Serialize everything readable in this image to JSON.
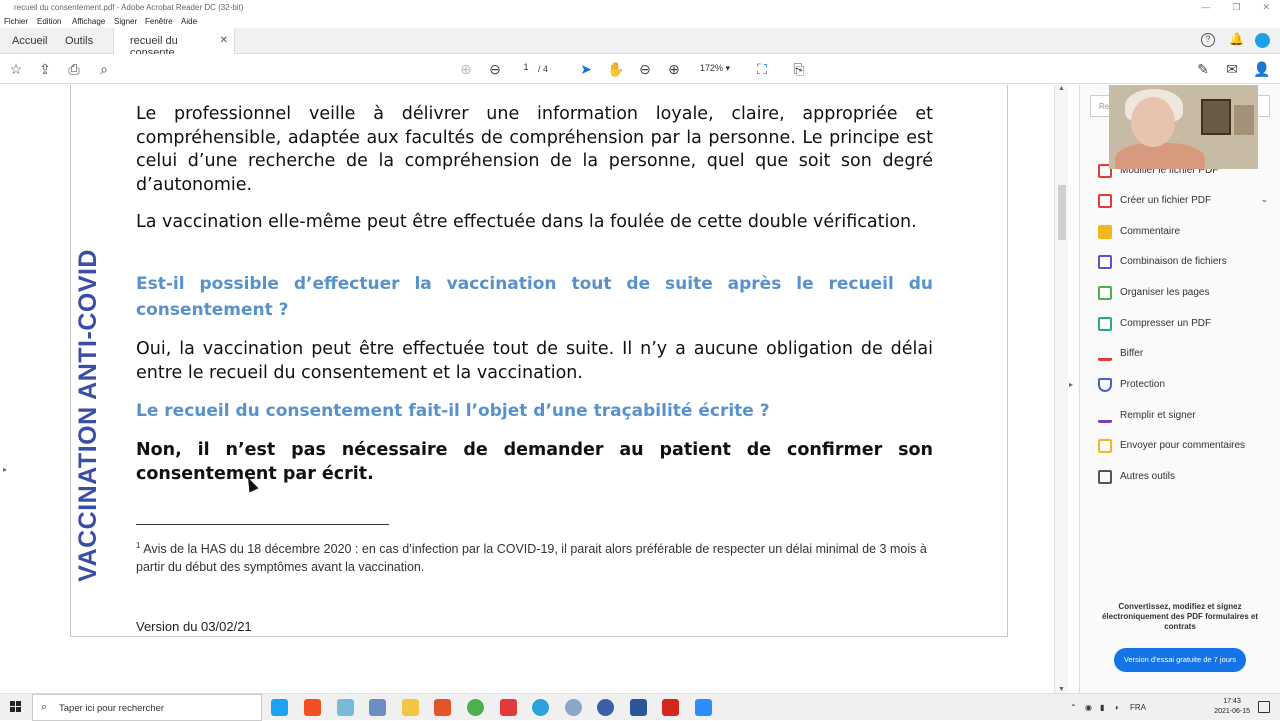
{
  "window": {
    "title": "recueil du consentement.pdf - Adobe Acrobat Reader DC (32-bit)"
  },
  "menu": [
    "Fichier",
    "Edition",
    "Affichage",
    "Signer",
    "Fenêtre",
    "Aide"
  ],
  "tabs": {
    "home": "Accueil",
    "tools": "Outils",
    "doc": "recueil du consente..."
  },
  "toolbar": {
    "page_current": "1",
    "page_total": "/ 4",
    "zoom": "172%"
  },
  "document": {
    "side_label": "VACCINATION ANTI-COVID",
    "para1": "Le professionnel veille à délivrer une information loyale, claire, appropriée et compréhensible, adaptée aux facultés de compréhension par la personne. Le principe est celui d’une recherche de la compréhension de la personne, quel que soit son degré d’autonomie.",
    "para2": "La vaccination elle-même peut être effectuée dans la foulée de cette double vérification.",
    "question1": "Est-il possible d’effectuer la vaccination tout de suite après le recueil du consentement ?",
    "answer1": "Oui, la vaccination peut être effectuée tout de suite. Il n’y a aucune obligation de délai entre le recueil du consentement et la vaccination.",
    "question2": "Le recueil du consentement fait-il l’objet d’une traçabilité écrite ?",
    "answer2": "Non, il n’est pas nécessaire de demander au patient de confirmer son consentement par écrit.",
    "footnote_num": "1",
    "footnote": "Avis de la HAS du 18 décembre 2020 : en cas d’infection par la COVID-19, il parait alors préférable de respecter un délai minimal de 3 mois à partir du début des symptômes avant la vaccination.",
    "version": "Version du 03/02/21"
  },
  "right_panel": {
    "search_placeholder": "Re...",
    "tools": [
      {
        "label": "Modifier le fichier PDF",
        "icon": "edit-pdf-icon",
        "color": "#e03a3a"
      },
      {
        "label": "Créer un fichier PDF",
        "icon": "create-pdf-icon",
        "color": "#e03a3a"
      },
      {
        "label": "Commentaire",
        "icon": "comment-icon",
        "color": "#f2b71f"
      },
      {
        "label": "Combinaison de fichiers",
        "icon": "combine-files-icon",
        "color": "#6b4cc8"
      },
      {
        "label": "Organiser les pages",
        "icon": "organize-pages-icon",
        "color": "#4caf50"
      },
      {
        "label": "Compresser un PDF",
        "icon": "compress-pdf-icon",
        "color": "#2aa88a"
      },
      {
        "label": "Biffer",
        "icon": "redact-icon",
        "color": "#e03a3a"
      },
      {
        "label": "Protection",
        "icon": "shield-icon",
        "color": "#4a5fc9"
      },
      {
        "label": "Remplir et signer",
        "icon": "fill-sign-icon",
        "color": "#7a3fb8"
      },
      {
        "label": "Envoyer pour commentaires",
        "icon": "send-review-icon",
        "color": "#f2b71f"
      },
      {
        "label": "Autres outils",
        "icon": "more-tools-icon",
        "color": "#555555"
      }
    ],
    "promo_text": "Convertissez, modifiez et signez électroniquement des PDF formulaires et contrats",
    "promo_button": "Version d'essai gratuite de 7 jours"
  },
  "taskbar": {
    "search_placeholder": "Taper ici pour rechercher",
    "language": "FRA",
    "time": "17:43",
    "date": "2021-06-15"
  }
}
